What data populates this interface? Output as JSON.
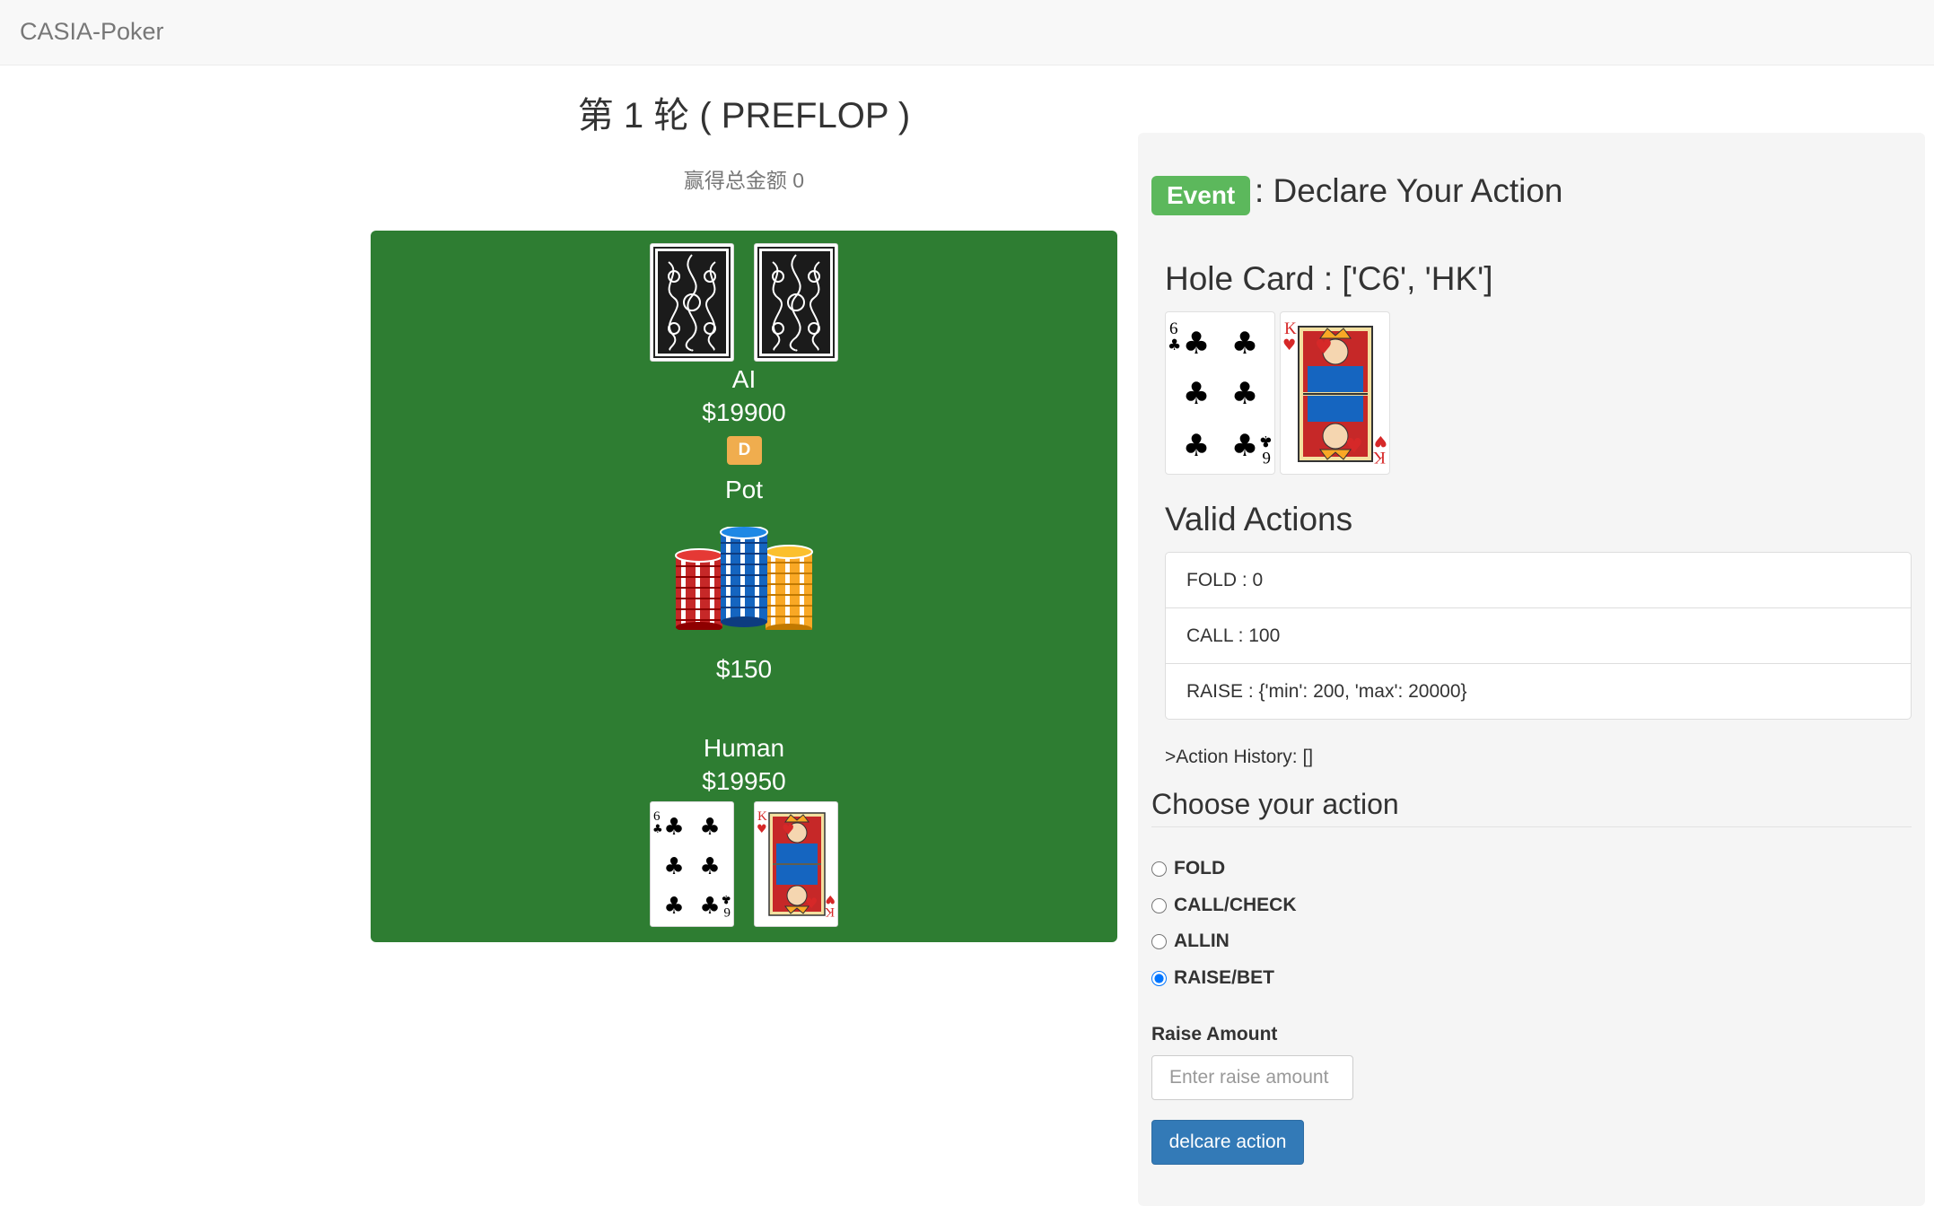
{
  "navbar": {
    "brand": "CASIA-Poker"
  },
  "game": {
    "round_title": "第 1 轮 ( PREFLOP )",
    "total_win": "赢得总金额 0"
  },
  "table": {
    "ai": {
      "name": "AI",
      "stack": "$19900",
      "dealer_badge": "D",
      "cards": [
        "back",
        "back"
      ]
    },
    "pot": {
      "label": "Pot",
      "amount": "$150"
    },
    "human": {
      "name": "Human",
      "stack": "$19950",
      "cards": [
        "6 of clubs",
        "K of hearts"
      ]
    }
  },
  "panel": {
    "event_badge": "Event",
    "event_text": ": Declare Your Action",
    "hole_card_title": "Hole Card : ['C6', 'HK']",
    "valid_actions_title": "Valid Actions",
    "valid_actions": [
      {
        "text": "FOLD : 0"
      },
      {
        "text": "CALL : 100"
      },
      {
        "text": "RAISE : {'min': 200, 'max': 20000}"
      }
    ],
    "action_history": ">Action History: []",
    "choose_title": "Choose your action",
    "options": [
      {
        "label": "FOLD",
        "checked": false
      },
      {
        "label": "CALL/CHECK",
        "checked": false
      },
      {
        "label": "ALLIN",
        "checked": false
      },
      {
        "label": "RAISE/BET",
        "checked": true
      }
    ],
    "raise_label": "Raise Amount",
    "raise_placeholder": "Enter raise amount",
    "raise_value": "",
    "submit_label": "delcare action"
  },
  "colors": {
    "table_green": "#2e7d32",
    "event_green": "#5cb85c",
    "dealer_orange": "#f0ad4e",
    "button_blue": "#337ab7",
    "card_red": "#d62828"
  }
}
